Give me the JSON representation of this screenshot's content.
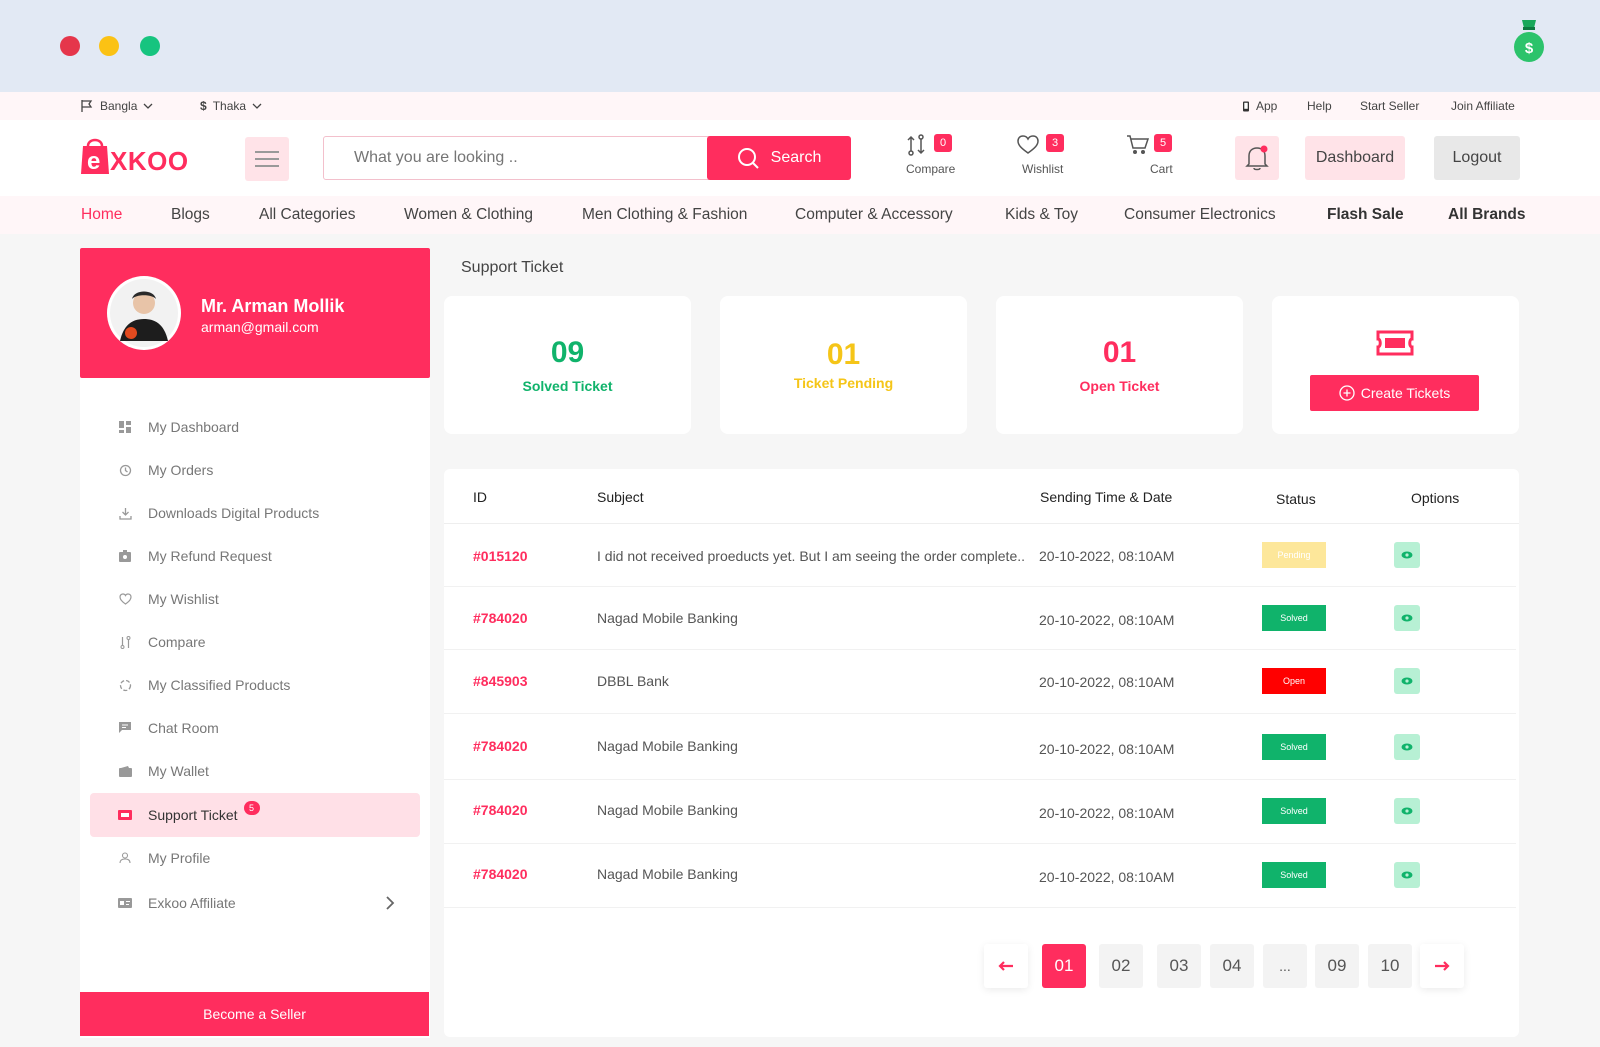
{
  "topbar": {
    "language": "Bangla",
    "currency_symbol": "$",
    "currency": "Thaka",
    "links": [
      "App",
      "Help",
      "Start Seller",
      "Join Affiliate"
    ]
  },
  "header": {
    "logo_e": "e",
    "logo_rest": "XKOO",
    "search_placeholder": "What you are looking ..",
    "search_button": "Search",
    "compare": {
      "label": "Compare",
      "count": "0"
    },
    "wishlist": {
      "label": "Wishlist",
      "count": "3"
    },
    "cart": {
      "label": "Cart",
      "count": "5"
    },
    "dashboard_button": "Dashboard",
    "logout_button": "Logout"
  },
  "nav": [
    "Home",
    "Blogs",
    "All Categories",
    "Women & Clothing",
    "Men Clothing & Fashion",
    "Computer & Accessory",
    "Kids & Toy",
    "Consumer Electronics",
    "Flash Sale",
    "All Brands"
  ],
  "profile": {
    "name": "Mr. Arman Mollik",
    "email": "arman@gmail.com"
  },
  "sidebar": {
    "items": [
      {
        "label": "My Dashboard",
        "icon": "dashboard-icon"
      },
      {
        "label": "My Orders",
        "icon": "history-icon"
      },
      {
        "label": "Downloads Digital Products",
        "icon": "download-icon"
      },
      {
        "label": "My Refund Request",
        "icon": "refund-icon"
      },
      {
        "label": "My Wishlist",
        "icon": "heart-icon"
      },
      {
        "label": "Compare",
        "icon": "compare-icon"
      },
      {
        "label": "My Classified Products",
        "icon": "classified-icon"
      },
      {
        "label": "Chat Room",
        "icon": "chat-icon"
      },
      {
        "label": "My Wallet",
        "icon": "wallet-icon"
      },
      {
        "label": "Support Ticket",
        "icon": "ticket-icon",
        "badge": "5",
        "active": true
      },
      {
        "label": "My Profile",
        "icon": "user-icon"
      },
      {
        "label": "Exkoo Affiliate",
        "icon": "affiliate-icon"
      }
    ],
    "become_seller": "Become a Seller"
  },
  "page_title": "Support Ticket",
  "stats": [
    {
      "value": "09",
      "label": "Solved Ticket",
      "color": "#10b36b"
    },
    {
      "value": "01",
      "label": "Ticket Pending",
      "color": "#f5c518"
    },
    {
      "value": "01",
      "label": "Open Ticket",
      "color": "#ff2d5e"
    }
  ],
  "create_ticket_button": "Create Tickets",
  "table": {
    "headers": [
      "ID",
      "Subject",
      "Sending Time & Date",
      "Status",
      "Options"
    ],
    "rows": [
      {
        "id": "#015120",
        "subject": "I did not received proeducts yet. But I am seeing the order complete..",
        "date": "20-10-2022,  08:10AM",
        "status": "Pending"
      },
      {
        "id": "#784020",
        "subject": "Nagad Mobile Banking",
        "date": "20-10-2022,  08:10AM",
        "status": "Solved"
      },
      {
        "id": "#845903",
        "subject": "DBBL Bank",
        "date": "20-10-2022,  08:10AM",
        "status": "Open"
      },
      {
        "id": "#784020",
        "subject": "Nagad Mobile Banking",
        "date": "20-10-2022,  08:10AM",
        "status": "Solved"
      },
      {
        "id": "#784020",
        "subject": "Nagad Mobile Banking",
        "date": "20-10-2022,  08:10AM",
        "status": "Solved"
      },
      {
        "id": "#784020",
        "subject": "Nagad Mobile Banking",
        "date": "20-10-2022,  08:10AM",
        "status": "Solved"
      }
    ]
  },
  "pagination": {
    "pages": [
      "01",
      "02",
      "03",
      "04",
      "...",
      "09",
      "10"
    ],
    "current": "01"
  },
  "colors": {
    "accent": "#ff2d5e",
    "solved": "#10b36b",
    "pending": "#fde79a",
    "open": "#ff0000",
    "chrome": "#e2e9f4"
  }
}
